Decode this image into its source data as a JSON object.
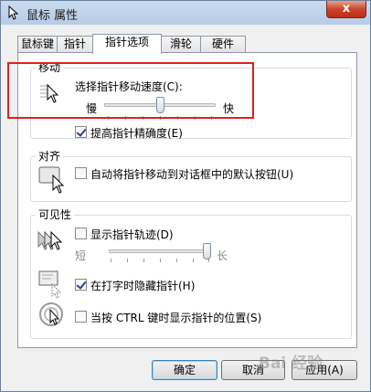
{
  "window": {
    "title": "鼠标 属性",
    "close_glyph": "x"
  },
  "tabs": [
    {
      "label": "鼠标键",
      "active": false
    },
    {
      "label": "指针",
      "active": false
    },
    {
      "label": "指针选项",
      "active": true
    },
    {
      "label": "滑轮",
      "active": false
    },
    {
      "label": "硬件",
      "active": false
    }
  ],
  "motion": {
    "group_title": "移动",
    "speed_label": "选择指针移动速度(C):",
    "slow_label": "慢",
    "fast_label": "快",
    "speed_fraction": 0.5,
    "precision_label": "提高指针精确度(E)",
    "precision_checked": true
  },
  "snap_to": {
    "group_title": "对齐",
    "label": "自动将指针移动到对话框中的默认按钮(U)",
    "checked": false
  },
  "visibility": {
    "group_title": "可见性",
    "trails_label": "显示指针轨迹(D)",
    "trails_checked": false,
    "short_label": "短",
    "long_label": "长",
    "trail_fraction": 1.0,
    "hide_typing_label": "在打字时隐藏指针(H)",
    "hide_typing_checked": true,
    "ctrl_label": "当按 CTRL 键时显示指针的位置(S)",
    "ctrl_checked": false
  },
  "buttons": {
    "ok": "确定",
    "cancel": "取消",
    "apply": "应用(A)"
  },
  "watermark": "Bai 经验"
}
